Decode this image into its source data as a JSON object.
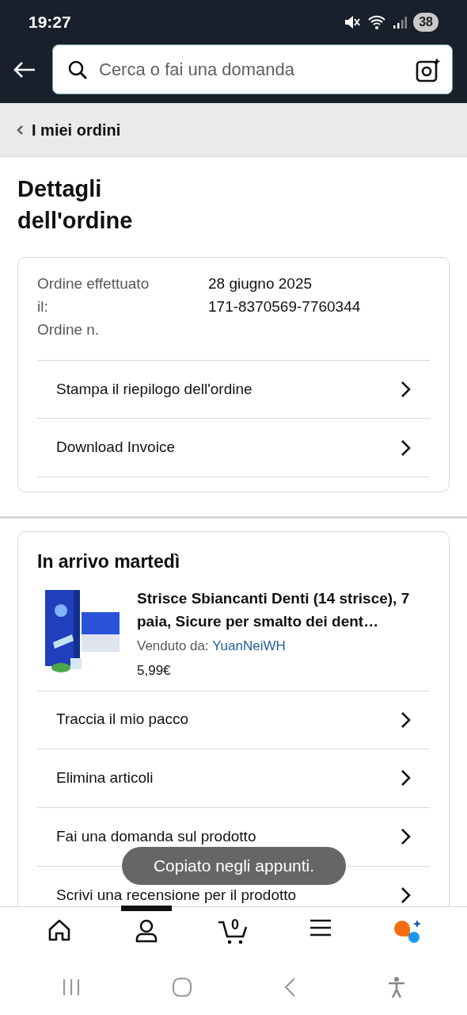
{
  "status_bar": {
    "time": "19:27",
    "battery": "38"
  },
  "search": {
    "placeholder": "Cerca o fai una domanda"
  },
  "breadcrumb": {
    "label": "I miei ordini"
  },
  "page_title": "Dettagli dell'ordine",
  "order_summary": {
    "labels": [
      "Ordine effettuato il:",
      "Ordine n."
    ],
    "values": [
      "28 giugno 2025",
      "171-8370569-7760344"
    ],
    "actions": [
      "Stampa il riepilogo dell'ordine",
      "Download Invoice"
    ]
  },
  "shipment": {
    "heading": "In arrivo martedì",
    "product": {
      "kind": "picture",
      "title": "Strisce Sbiancanti Denti (14 strisce), 7 paia, Sicure per smalto dei dent…",
      "seller_label": "Venduto da:",
      "seller": "YuanNeiWH",
      "price": "5,99€"
    },
    "actions": [
      "Traccia il mio pacco",
      "Elimina articoli",
      "Fai una domanda sul prodotto",
      "Scrivi una recensione per il prodotto"
    ]
  },
  "toast": "Copiato negli appunti.",
  "bottom_nav": [
    {
      "kind": "home",
      "selected": false
    },
    {
      "kind": "account",
      "selected": true
    },
    {
      "kind": "cart",
      "count": "0",
      "selected": false
    },
    {
      "kind": "menu",
      "selected": false
    },
    {
      "kind": "assistant",
      "selected": false
    }
  ]
}
